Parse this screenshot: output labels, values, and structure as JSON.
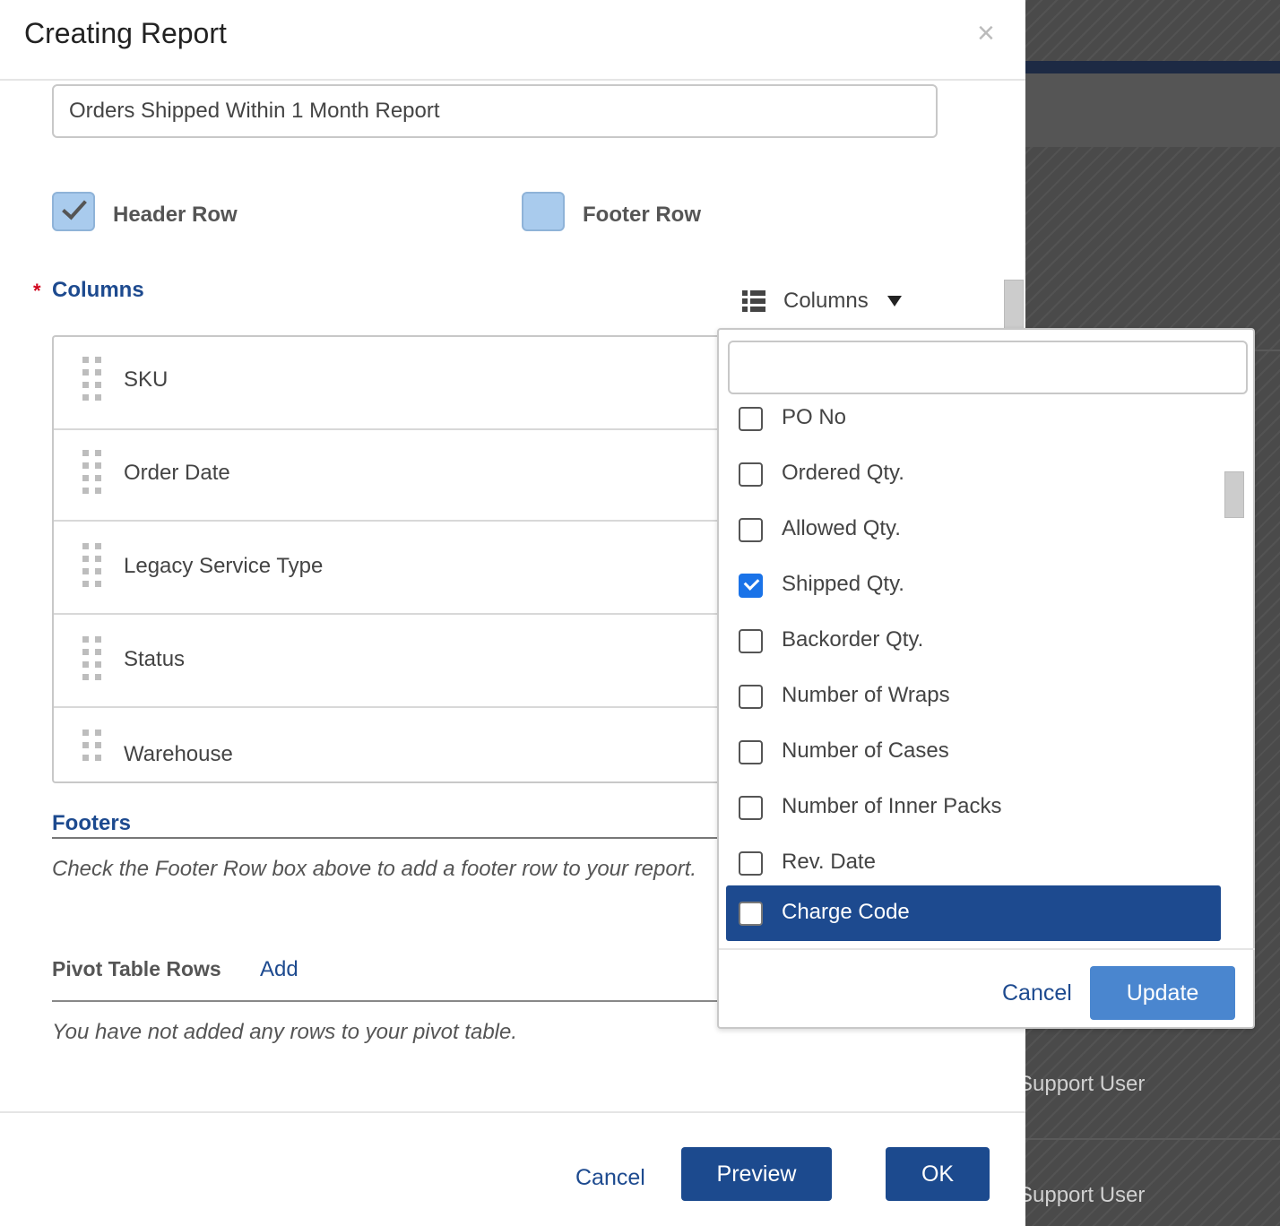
{
  "dialog": {
    "title": "Creating Report",
    "close_symbol": "×",
    "report_name": "Orders Shipped Within 1 Month Report"
  },
  "options": {
    "header_row": {
      "label": "Header Row",
      "checked": true
    },
    "footer_row": {
      "label": "Footer Row",
      "checked": false
    }
  },
  "columns": {
    "required_marker": "*",
    "title": "Columns",
    "picker_label": "Columns",
    "items": [
      {
        "label": "SKU"
      },
      {
        "label": "Order Date"
      },
      {
        "label": "Legacy Service Type"
      },
      {
        "label": "Status"
      },
      {
        "label": "Warehouse"
      }
    ]
  },
  "column_picker": {
    "search_value": "",
    "options": [
      {
        "label": "PO No",
        "checked": false
      },
      {
        "label": "Ordered Qty.",
        "checked": false
      },
      {
        "label": "Allowed Qty.",
        "checked": false
      },
      {
        "label": "Shipped Qty.",
        "checked": true
      },
      {
        "label": "Backorder Qty.",
        "checked": false
      },
      {
        "label": "Number of Wraps",
        "checked": false
      },
      {
        "label": "Number of Cases",
        "checked": false
      },
      {
        "label": "Number of Inner Packs",
        "checked": false
      },
      {
        "label": "Rev. Date",
        "checked": false
      },
      {
        "label": "Charge Code",
        "checked": false,
        "highlighted": true
      }
    ],
    "cancel_label": "Cancel",
    "update_label": "Update"
  },
  "footers": {
    "title": "Footers",
    "note": "Check the Footer Row box above to add a footer row to your report."
  },
  "pivot": {
    "title": "Pivot Table Rows",
    "add_label": "Add",
    "empty_note": "You have not added any rows to your pivot table."
  },
  "actions": {
    "cancel_label": "Cancel",
    "preview_label": "Preview",
    "ok_label": "OK"
  },
  "background": {
    "rows": [
      "Support User",
      "Support User"
    ]
  },
  "colors": {
    "primary": "#1c4a8e",
    "update_button": "#4a86cf",
    "checkbox_fill": "#a9cbed",
    "checked_accent": "#1a73e8",
    "required": "#d0021b"
  }
}
